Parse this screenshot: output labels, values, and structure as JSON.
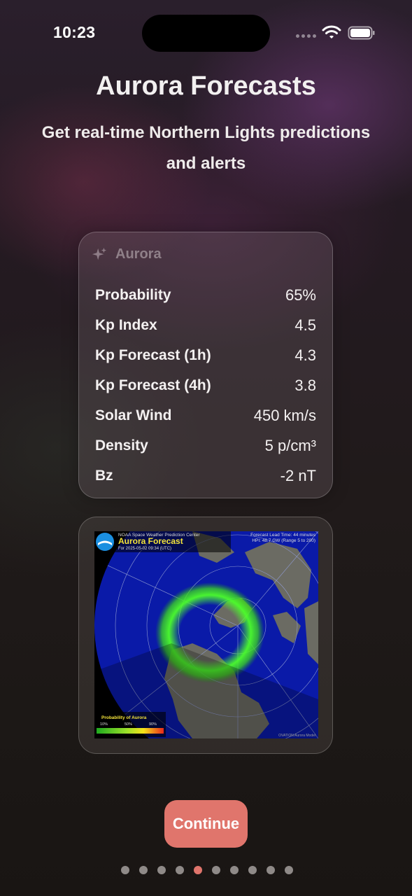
{
  "status_bar": {
    "time": "10:23"
  },
  "onboarding": {
    "title": "Aurora Forecasts",
    "subtitle": "Get real-time Northern Lights predictions and alerts"
  },
  "widget": {
    "title": "Aurora",
    "icon": "sparkle-icon",
    "stats": [
      {
        "label": "Probability",
        "value": "65%"
      },
      {
        "label": "Kp Index",
        "value": "4.5"
      },
      {
        "label": "Kp Forecast (1h)",
        "value": "4.3"
      },
      {
        "label": "Kp Forecast (4h)",
        "value": "3.8"
      },
      {
        "label": "Solar Wind",
        "value": "450 km/s"
      },
      {
        "label": "Density",
        "value": "5 p/cm³"
      },
      {
        "label": "Bz",
        "value": "-2 nT"
      }
    ]
  },
  "forecast_map": {
    "agency": "NOAA Space Weather Prediction Center",
    "title": "Aurora Forecast",
    "date": "For 2025-05-02 09:34 (UTC)",
    "lead_time": "Forecast Lead Time:  44 minutes",
    "hpi": "HPI:  48.7 GW (Range 5 to 200)",
    "legend_title": "Probability of Aurora",
    "legend_ticks": [
      "10%",
      "50%",
      "90%"
    ],
    "credit": "OVATION Aurora Model"
  },
  "actions": {
    "continue_label": "Continue"
  },
  "pagination": {
    "total": 10,
    "current": 5
  },
  "colors": {
    "accent": "#e0756c",
    "dot_inactive": "#8f8a88",
    "aurora_green": "#4cff2a",
    "ocean_blue": "#0a1aa8"
  }
}
